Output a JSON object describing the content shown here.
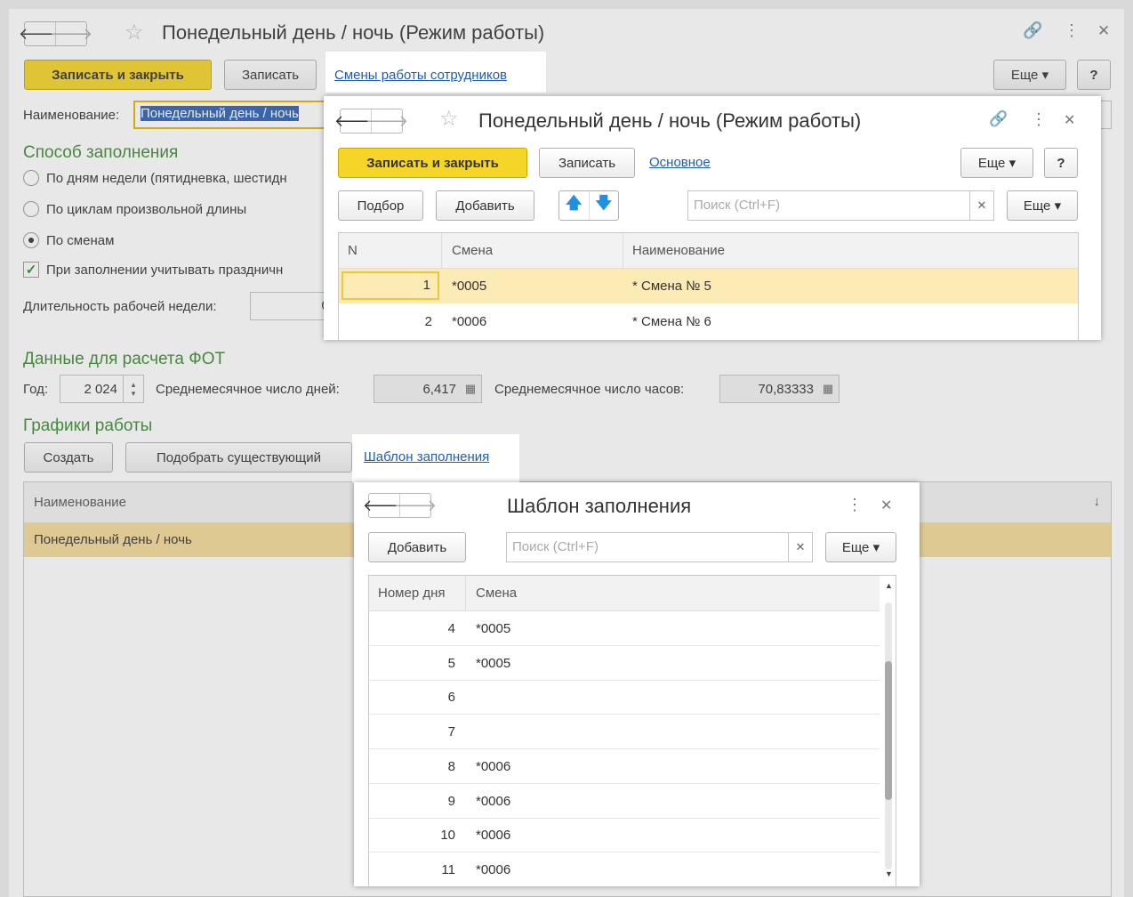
{
  "main": {
    "title": "Понедельный день / ночь (Режим работы)",
    "save_close": "Записать и закрыть",
    "save": "Записать",
    "tab_link": "Смены работы сотрудников",
    "more": "Еще",
    "help": "?",
    "name_label": "Наименование:",
    "name_value": "Понедельный день / ночь",
    "fill_method_title": "Способ заполнения",
    "radio_week": "По дням недели (пятидневка, шестидн",
    "radio_cycles": "По циклам произвольной длины",
    "radio_shifts": "По сменам",
    "holidays_check": "При заполнении учитывать праздничн",
    "week_length_label": "Длительность рабочей недели:",
    "week_length_value": "0,",
    "fot_title": "Данные для расчета ФОТ",
    "year_label": "Год:",
    "year_value": "2 024",
    "avg_days_label": "Среднемесячное число дней:",
    "avg_days_value": "6,417",
    "avg_hours_label": "Среднемесячное число часов:",
    "avg_hours_value": "70,83333",
    "schedules_title": "Графики работы",
    "create": "Создать",
    "pick_existing": "Подобрать существующий",
    "template_link": "Шаблон заполнения",
    "list_header": "Наименование",
    "list_sort": "↓",
    "list_rows": [
      "Понедельный день / ночь"
    ]
  },
  "shifts_window": {
    "title": "Понедельный день / ночь (Режим работы)",
    "save_close": "Записать и закрыть",
    "save": "Записать",
    "main_link": "Основное",
    "more": "Еще",
    "help": "?",
    "pick": "Подбор",
    "add": "Добавить",
    "search_placeholder": "Поиск (Ctrl+F)",
    "more2": "Еще",
    "columns": [
      "N",
      "Смена",
      "Наименование"
    ],
    "rows": [
      {
        "n": "1",
        "shift": "*0005",
        "name": "* Смена № 5"
      },
      {
        "n": "2",
        "shift": "*0006",
        "name": "* Смена № 6"
      }
    ]
  },
  "template_window": {
    "title": "Шаблон заполнения",
    "add": "Добавить",
    "search_placeholder": "Поиск (Ctrl+F)",
    "more": "Еще",
    "columns": [
      "Номер дня",
      "Смена"
    ],
    "rows": [
      {
        "day": "4",
        "shift": "*0005"
      },
      {
        "day": "5",
        "shift": "*0005"
      },
      {
        "day": "6",
        "shift": ""
      },
      {
        "day": "7",
        "shift": ""
      },
      {
        "day": "8",
        "shift": "*0006"
      },
      {
        "day": "9",
        "shift": "*0006"
      },
      {
        "day": "10",
        "shift": "*0006"
      },
      {
        "day": "11",
        "shift": "*0006"
      }
    ]
  },
  "colors": {
    "accent_yellow": "#f5d527",
    "link_blue": "#1f5db4",
    "section_green": "#3a8c2f",
    "selected_row": "#fdebb5"
  }
}
